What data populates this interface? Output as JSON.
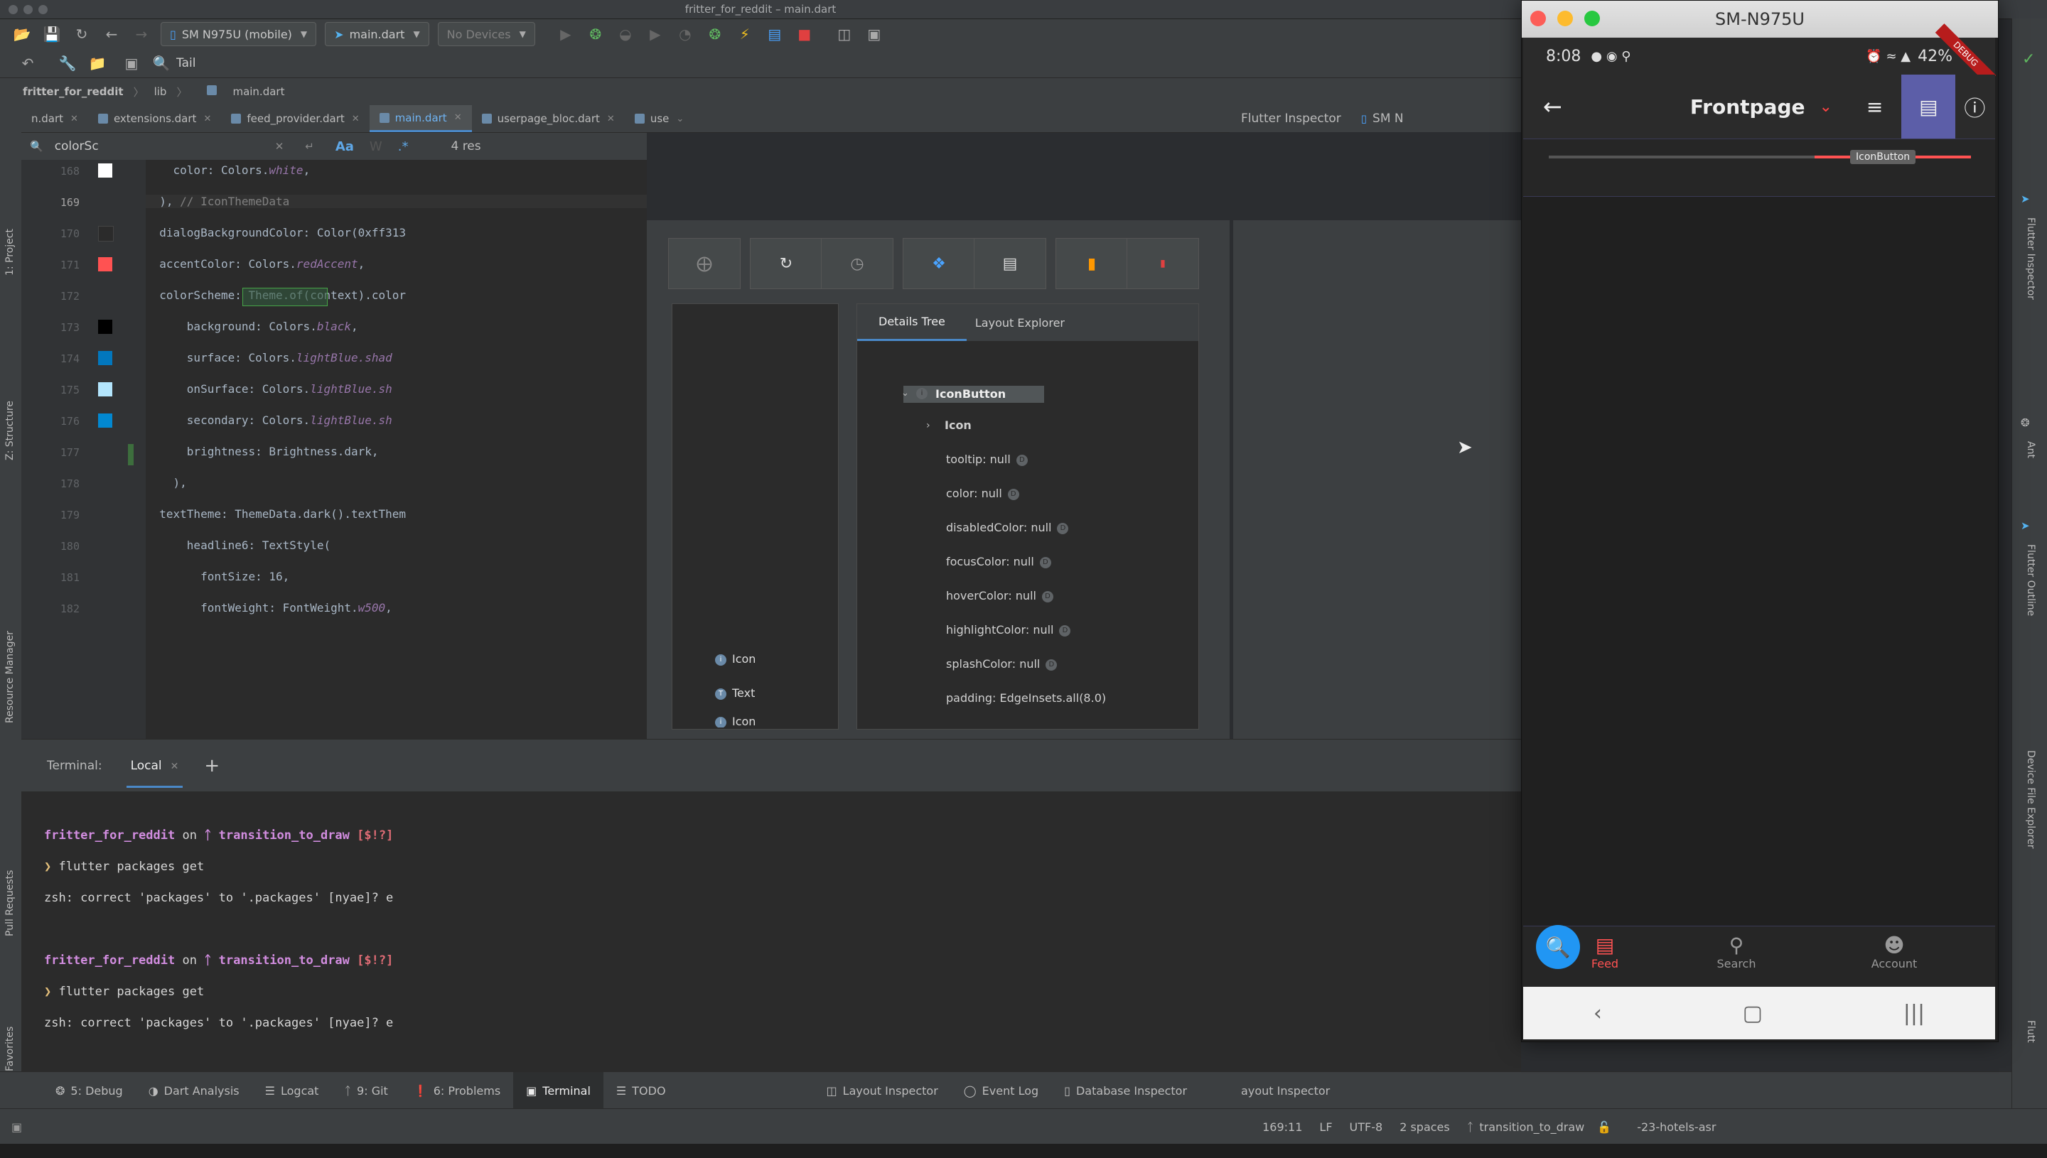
{
  "window": {
    "title": "fritter_for_reddit – main.dart"
  },
  "toolbar": {
    "device_selector": "SM N975U (mobile)",
    "run_config": "main.dart",
    "no_devices": "No Devices",
    "tail_label": "Tail"
  },
  "breadcrumb": {
    "project": "fritter_for_reddit",
    "folder": "lib",
    "file": "main.dart"
  },
  "left_strip": {
    "project": "1: Project",
    "structure": "Z: Structure",
    "resource_manager": "Resource Manager",
    "pull_requests": "Pull Requests",
    "favorites": "Favorites"
  },
  "tabs": [
    {
      "label": "n.dart"
    },
    {
      "label": "extensions.dart"
    },
    {
      "label": "feed_provider.dart"
    },
    {
      "label": "main.dart"
    },
    {
      "label": "userpage_bloc.dart"
    },
    {
      "label": "use"
    }
  ],
  "right_header": {
    "inspector": "Flutter Inspector",
    "device": "SM N"
  },
  "search": {
    "query": "colorSc",
    "options": [
      "Aa",
      "W",
      ".*"
    ],
    "results": "4 res"
  },
  "editor": {
    "lines": [
      {
        "n": "168",
        "pre": "    color: Colors.",
        "em": "white",
        "post": ","
      },
      {
        "n": "169",
        "pre": "  ), ",
        "em": "",
        "post": "// IconThemeData"
      },
      {
        "n": "170",
        "pre": "  dialogBackgroundColor: Color(0xff313",
        "em": "",
        "post": ""
      },
      {
        "n": "171",
        "pre": "  accentColor: Colors.",
        "em": "redAccent",
        "post": ","
      },
      {
        "n": "172",
        "pre": "  colorScheme: Theme.of(context).color",
        "em": "",
        "post": ""
      },
      {
        "n": "173",
        "pre": "      background: Colors.",
        "em": "black",
        "post": ","
      },
      {
        "n": "174",
        "pre": "      surface: Colors.",
        "em": "lightBlue",
        "post": ".shad"
      },
      {
        "n": "175",
        "pre": "      onSurface: Colors.",
        "em": "lightBlue",
        "post": ".sh"
      },
      {
        "n": "176",
        "pre": "      secondary: Colors.",
        "em": "lightBlue",
        "post": ".sh"
      },
      {
        "n": "177",
        "pre": "      brightness: Brightness.dark,",
        "em": "",
        "post": ""
      },
      {
        "n": "178",
        "pre": "    ),",
        "em": "",
        "post": ""
      },
      {
        "n": "179",
        "pre": "  textTheme: ThemeData.dark().textThem",
        "em": "",
        "post": ""
      },
      {
        "n": "180",
        "pre": "      headline6: TextStyle(",
        "em": "",
        "post": ""
      },
      {
        "n": "181",
        "pre": "        fontSize: 16,",
        "em": "",
        "post": ""
      },
      {
        "n": "182",
        "pre": "        fontWeight: FontWeight.",
        "em": "w500",
        "post": ","
      }
    ],
    "swatch_colors": [
      "#ffffff",
      "#2b2b2b",
      "#ff5252",
      "#000000",
      "#0277bd",
      "#b3e5fc",
      "#0288d1"
    ]
  },
  "inspector": {
    "details_tab": "Details Tree",
    "layout_tab": "Layout Explorer",
    "node_title": "IconButton",
    "child": "Icon",
    "props": [
      "tooltip: null",
      "color: null",
      "disabledColor: null",
      "focusColor: null",
      "hoverColor: null",
      "highlightColor: null",
      "splashColor: null",
      "padding: EdgeInsets.all(8.0)"
    ],
    "widget_tree": [
      "Icon",
      "Text",
      "Icon"
    ]
  },
  "terminal": {
    "header": "Terminal:",
    "tab": "Local",
    "prompt_dir": "fritter_for_reddit",
    "on": "on",
    "branch": "transition_to_draw",
    "status": "[$!?]",
    "command": "flutter packages get",
    "correction": "zsh: correct 'packages' to '.packages' [nyae]? e"
  },
  "tool_tabs": [
    "5: Debug",
    "Dart Analysis",
    "Logcat",
    "9: Git",
    "6: Problems",
    "Terminal",
    "TODO"
  ],
  "tool_tabs_right": [
    "Layout Inspector",
    "Event Log",
    "Database Inspector"
  ],
  "status_bar": {
    "position": "169:11",
    "line_sep": "LF",
    "encoding": "UTF-8",
    "indent": "2 spaces",
    "branch": "transition_to_draw",
    "right": "-23-hotels-asr",
    "layout_inspector_tail": "ayout Inspector"
  },
  "right_strip": {
    "flutter_inspector": "Flutter Inspector",
    "ant": "Ant",
    "flutter_outline": "Flutter Outline",
    "device_file_explorer": "Device File Explorer",
    "flutter": "Flutt"
  },
  "emulator": {
    "title": "SM-N975U",
    "time": "8:08",
    "battery": "42%",
    "debug_ribbon": "DEBUG",
    "appbar_title": "Frontpage",
    "tooltip": "IconButton",
    "nav": [
      {
        "label": "Feed"
      },
      {
        "label": "Search"
      },
      {
        "label": "Account"
      }
    ]
  }
}
